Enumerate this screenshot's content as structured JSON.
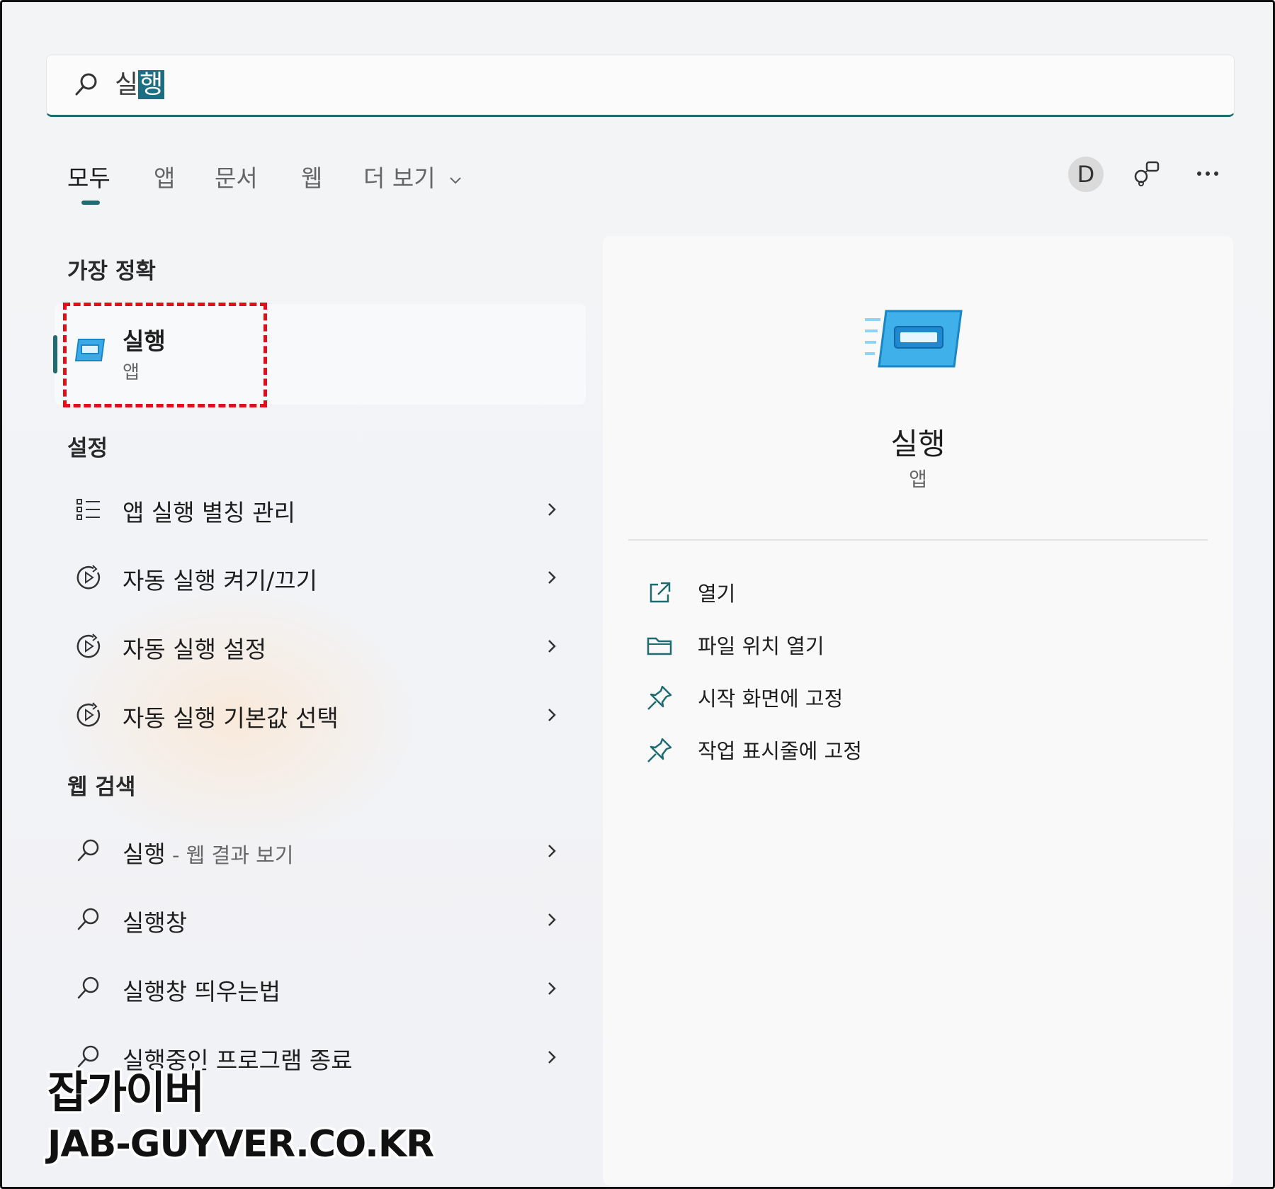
{
  "search": {
    "query_plain": "실",
    "query_selected": "행"
  },
  "tabs": [
    {
      "label": "모두",
      "active": true
    },
    {
      "label": "앱"
    },
    {
      "label": "문서"
    },
    {
      "label": "웹"
    },
    {
      "label": "더 보기"
    }
  ],
  "header_right": {
    "avatar_letter": "D"
  },
  "sections": {
    "best_match": "가장 정확",
    "settings": "설정",
    "web_search": "웹 검색"
  },
  "best_match": {
    "title": "실행",
    "subtitle": "앱"
  },
  "settings_items": [
    {
      "label": "앱 실행 별칭 관리",
      "icon": "list-icon"
    },
    {
      "label": "자동 실행 켜기/끄기",
      "icon": "autoplay-icon"
    },
    {
      "label": "자동 실행 설정",
      "icon": "autoplay-icon"
    },
    {
      "label": "자동 실행 기본값 선택",
      "icon": "autoplay-icon"
    }
  ],
  "web_items": [
    {
      "label": "실행",
      "suffix": " - 웹 결과 보기"
    },
    {
      "label": "실행창",
      "suffix": ""
    },
    {
      "label": "실행창 띄우는법",
      "suffix": ""
    },
    {
      "label": "실행중인 프로그램 종료",
      "suffix": ""
    }
  ],
  "preview": {
    "title": "실행",
    "subtitle": "앱",
    "actions": [
      {
        "label": "열기",
        "icon": "open-external-icon"
      },
      {
        "label": "파일 위치 열기",
        "icon": "folder-icon"
      },
      {
        "label": "시작 화면에 고정",
        "icon": "pin-icon"
      },
      {
        "label": "작업 표시줄에 고정",
        "icon": "pin-icon"
      }
    ]
  },
  "watermark": {
    "line1": "잡가이버",
    "line2": "JAB-GUYVER.CO.KR"
  },
  "colors": {
    "accent": "#1f6b72",
    "highlight_border": "#e0101a",
    "selection": "#1c6f83"
  }
}
